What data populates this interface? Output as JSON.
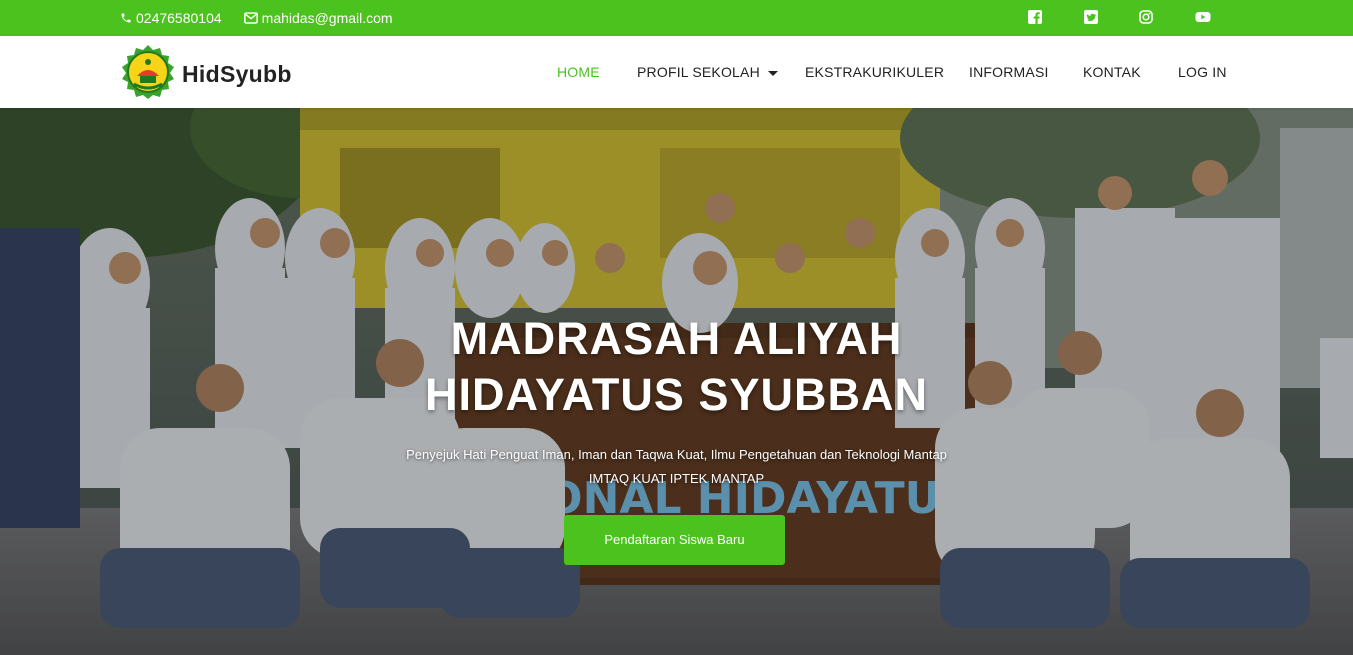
{
  "topbar": {
    "phone": "02476580104",
    "email": "mahidas@gmail.com",
    "phone_icon": "phone-icon",
    "email_icon": "envelope-icon",
    "social": [
      "facebook-icon",
      "twitter-icon",
      "instagram-icon",
      "youtube-icon"
    ],
    "color": "#4cc21e"
  },
  "navbar": {
    "brand": "HidSyubb",
    "logo": "school-crest-logo",
    "items": [
      {
        "label": "HOME",
        "active": true
      },
      {
        "label": "PROFIL SEKOLAH",
        "dropdown": true
      },
      {
        "label": "EKSTRAKURIKULER"
      },
      {
        "label": "INFORMASI"
      },
      {
        "label": "KONTAK"
      },
      {
        "label": "LOG IN"
      }
    ],
    "active_color": "#4cc21e"
  },
  "hero": {
    "title_line1": "MADRASAH ALIYAH",
    "title_line2": "HIDAYATUS SYUBBAN",
    "subtitle": "Penyejuk Hati Penguat Iman, Iman dan Taqwa Kuat, Ilmu Pengetahuan dan Teknologi Mantap",
    "tagline": "IMTAQ KUAT IPTEK MANTAP",
    "button": "Pendaftaran Siswa Baru",
    "banner_text": "NASIONAL HIDAYATUS SYUBB",
    "banner_label": "banner-text"
  }
}
